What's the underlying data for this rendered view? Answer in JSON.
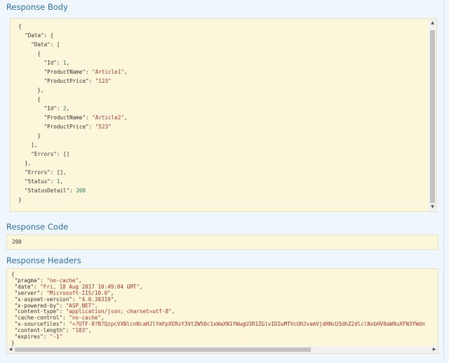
{
  "response_body": {
    "title": "Response Body",
    "lines": [
      "{",
      "  \"Data\": {",
      "    \"Data\": [",
      "      {",
      "        \"Id\": 1,",
      "        \"ProductName\": \"Article1\",",
      "        \"ProductPrice\": \"123\"",
      "      },",
      "      {",
      "        \"Id\": 2,",
      "        \"ProductName\": \"Article2\",",
      "        \"ProductPrice\": \"523\"",
      "      }",
      "    ],",
      "    \"Errors\": []",
      "  },",
      "  \"Errors\": [],",
      "  \"Status\": 1,",
      "  \"StatusDetail\": 200",
      "}"
    ]
  },
  "response_code": {
    "title": "Response Code",
    "value": "200"
  },
  "response_headers": {
    "title": "Response Headers",
    "lines": [
      "{",
      " \"pragma\": \"no-cache\",",
      " \"date\": \"Fri, 18 Aug 2017 10:49:04 GMT\",",
      " \"server\": \"Microsoft-IIS/10.0\",",
      " \"x-aspnet-version\": \"4.0.30319\",",
      " \"x-powered-by\": \"ASP.NET\",",
      " \"content-type\": \"application/json; charset=utf-8\",",
      " \"cache-control\": \"no-cache\",",
      " \"x-sourcefiles\": \"=?UTF-8?B?QzpcVXNlcnNcaHJlYmFpXERvY3VtZW50c1xWaXN1YWwgU3R1ZGlvIDIwMTVcUHJvamVjdHNcU3dhZ2dlclNvbHV0aW9uXFN3YWdn",
      " \"content-length\": \"183\",",
      " \"expires\": \"-1\"",
      "}"
    ]
  }
}
